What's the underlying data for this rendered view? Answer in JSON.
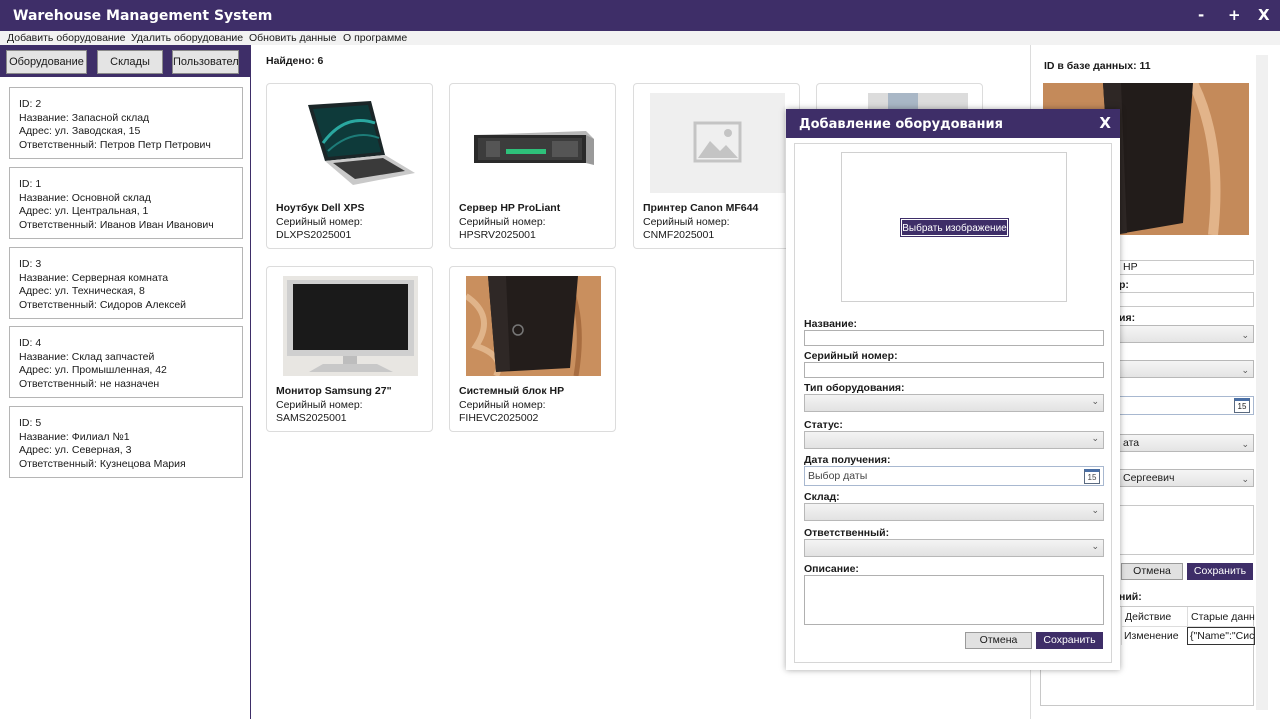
{
  "app": {
    "title": "Warehouse Management System",
    "minimize": "-",
    "maximize": "+",
    "close": "X"
  },
  "menu": [
    "Добавить оборудование",
    "Удалить оборудование",
    "Обновить данные",
    "О программе"
  ],
  "nav": {
    "equipment": "Оборудование",
    "warehouses": "Склады",
    "users": "Пользователи"
  },
  "warehouses": [
    {
      "id": "ID: 2",
      "name": "Название: Запасной склад",
      "address": "Адрес: ул. Заводская, 15",
      "resp": "Ответственный: Петров Петр Петрович"
    },
    {
      "id": "ID: 1",
      "name": "Название: Основной склад",
      "address": "Адрес: ул. Центральная, 1",
      "resp": "Ответственный: Иванов Иван Иванович"
    },
    {
      "id": "ID: 3",
      "name": "Название: Серверная комната",
      "address": "Адрес: ул. Техническая, 8",
      "resp": "Ответственный: Сидоров Алексей"
    },
    {
      "id": "ID: 4",
      "name": "Название: Склад запчастей",
      "address": "Адрес: ул. Промышленная, 42",
      "resp": "Ответственный: не назначен"
    },
    {
      "id": "ID: 5",
      "name": "Название: Филиал №1",
      "address": "Адрес: ул. Северная, 3",
      "resp": "Ответственный: Кузнецова Мария"
    }
  ],
  "found": "Найдено: 6",
  "serial_label": "Серийный номер:",
  "equipment": [
    {
      "name": "Ноутбук Dell XPS",
      "serial": "DLXPS2025001"
    },
    {
      "name": "Сервер HP ProLiant",
      "serial": "HPSRV2025001"
    },
    {
      "name": "Принтер Canon MF644",
      "serial": "CNMF2025001"
    },
    {
      "name": "",
      "serial": ""
    },
    {
      "name": "Монитор Samsung 27\"",
      "serial": "SAMS2025001"
    },
    {
      "name": "Системный блок HP",
      "serial": "FIHEVC2025002"
    }
  ],
  "details": {
    "id_label": "ID в базе данных: 11",
    "name_value": "HP",
    "serial_partial": "р:",
    "type_partial": "ия:",
    "warehouse_partial": "ата",
    "responsible_partial": "Сергеевич",
    "date_icon": "15",
    "cancel": "Отмена",
    "save": "Сохранить",
    "history_partial": "ний:",
    "history_headers": [
      "Действие",
      "Старые данны"
    ],
    "history_rows": [
      [
        "Изменение",
        "{\"Name\":\"Систе"
      ]
    ]
  },
  "dialog": {
    "title": "Добавление оборудования",
    "close": "X",
    "choose_image": "Выбрать изображение",
    "name_label": "Название:",
    "serial_label": "Серийный номер:",
    "type_label": "Тип оборудования:",
    "status_label": "Статус:",
    "date_label": "Дата получения:",
    "date_placeholder": "Выбор даты",
    "date_icon": "15",
    "warehouse_label": "Склад:",
    "responsible_label": "Ответственный:",
    "description_label": "Описание:",
    "cancel": "Отмена",
    "save": "Сохранить"
  }
}
